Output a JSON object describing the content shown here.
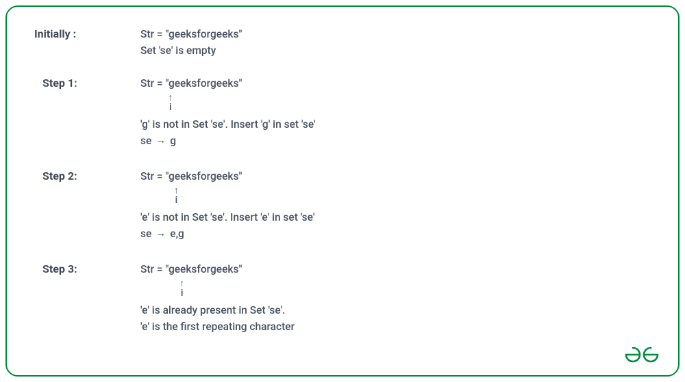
{
  "initially": {
    "label": "Initially :",
    "lines": [
      "Str = \"geeksforgeeks\"",
      "Set 'se' is empty"
    ]
  },
  "steps": [
    {
      "label": "Step 1:",
      "str_prefix": "Str = \"",
      "str_value": "geeksforgeeks",
      "str_suffix": "\"",
      "pointer_char_index": 0,
      "pointer_label": "i",
      "explain": "'g' is not in Set 'se'. Insert 'g' in set 'se'",
      "set_name": "se",
      "set_arrow": "→",
      "set_contents": "g"
    },
    {
      "label": "Step 2:",
      "str_prefix": "Str = \"",
      "str_value": "geeksforgeeks",
      "str_suffix": "\"",
      "pointer_char_index": 1,
      "pointer_label": "i",
      "explain": "'e' is not in Set 'se'. Insert 'e' in set 'se'",
      "set_name": "se",
      "set_arrow": "→",
      "set_contents": "e,g"
    },
    {
      "label": "Step 3:",
      "str_prefix": "Str = \"",
      "str_value": "geeksforgeeks",
      "str_suffix": "\"",
      "pointer_char_index": 2,
      "pointer_label": "i",
      "explain": "'e' is already present in Set 'se'.",
      "explain2": "'e' is the first repeating character"
    }
  ],
  "pointer_arrow": "↑"
}
